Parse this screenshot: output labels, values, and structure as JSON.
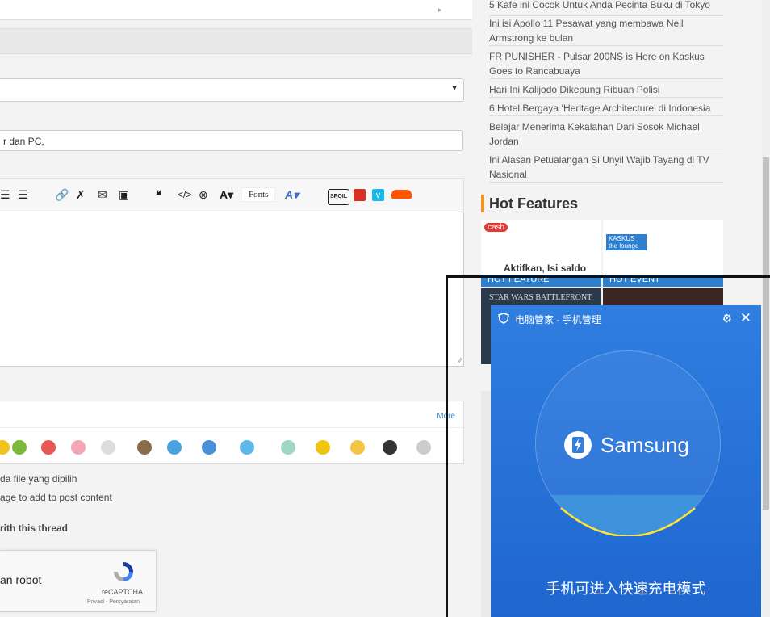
{
  "editor": {
    "title_value": "r dan PC,",
    "toolbar": {
      "fonts_label": "Fonts",
      "spoil_label": "SPOIL"
    },
    "smilies": {
      "more_label": "More",
      "colors": [
        "#f2c31b",
        "#7cbb39",
        "#e85656",
        "#f3a6b4",
        "#dddddd",
        "#8a6b4a",
        "#4aa3df",
        "#4a90d9",
        "#5bb8e8",
        "#9fd6c4",
        "#f1c40f",
        "#f4c542",
        "#333333",
        "#cccccc"
      ]
    },
    "info": {
      "line1": "da file yang dipilih",
      "line2": "age to add to post content",
      "line3": "rith this thread"
    },
    "recaptcha": {
      "robot_label": "an robot",
      "brand": "reCAPTCHA",
      "links": "Privasi - Persyaratan"
    }
  },
  "sidebar": {
    "news": [
      "5 Kafe ini Cocok Untuk Anda Pecinta Buku di Tokyo",
      "Ini isi Apollo 11 Pesawat yang membawa Neil Armstrong ke bulan",
      "FR PUNISHER - Pulsar 200NS is Here on Kaskus Goes to Rancabuaya",
      "Hari Ini Kalijodo Dikepung Ribuan Polisi",
      "6 Hotel Bergaya ‘Heritage Architecture’ di Indonesia",
      "Belajar Menerima Kekalahan Dari Sosok Michael Jordan",
      "Ini Alasan Petualangan Si Unyil Wajib Tayang di TV Nasional"
    ],
    "hot_features_title": "Hot Features",
    "thumbs": [
      {
        "label": "Aktifkan, Isi saldo",
        "sub": "HOT FEATURE",
        "brand": "cash"
      },
      {
        "label": "HOT EVENT",
        "sub": "KASKUS the lounge",
        "brand": "lounge"
      },
      {
        "label": "STAR WARS BATTLEFRONT",
        "sub": "",
        "brand": "game"
      },
      {
        "label": "",
        "sub": "",
        "brand": "dark"
      }
    ]
  },
  "popup": {
    "title": "电脑管家 - 手机管理",
    "brand": "Samsung",
    "message": "手机可进入快速充电模式",
    "accent": "#ffe338"
  }
}
